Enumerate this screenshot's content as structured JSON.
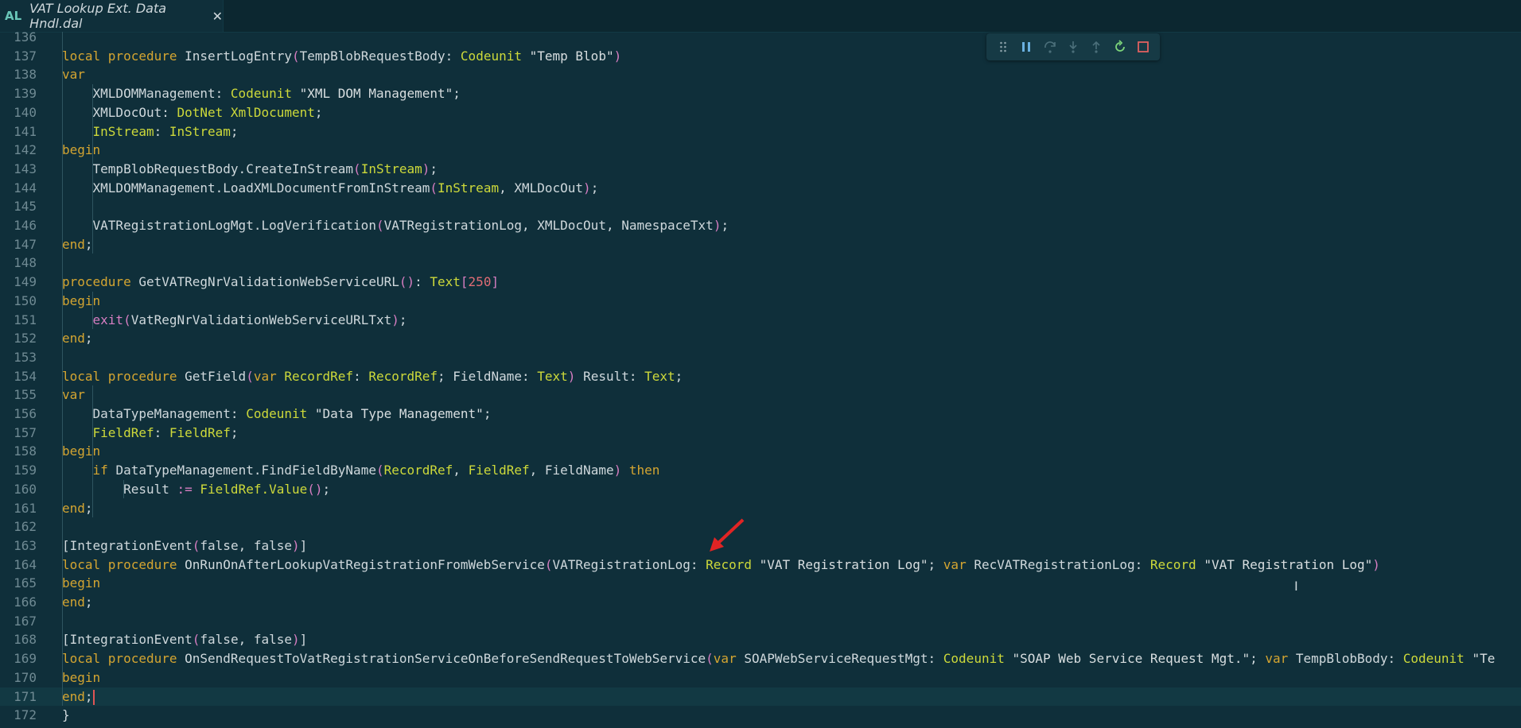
{
  "tab": {
    "language_badge": "AL",
    "title": "VAT Lookup Ext. Data Hndl.dal",
    "close_glyph": "✕"
  },
  "debug_toolbar": {
    "icons": [
      "drag-handle-icon",
      "pause-icon",
      "step-over-icon",
      "step-into-icon",
      "step-out-icon",
      "restart-icon",
      "stop-icon"
    ]
  },
  "editor": {
    "current_line": 171,
    "lines": [
      {
        "n": "136",
        "tokens": []
      },
      {
        "n": "137",
        "tokens": [
          [
            "kw",
            "local procedure "
          ],
          [
            "fn",
            "InsertLogEntry"
          ],
          [
            "par",
            "("
          ],
          [
            "fn",
            "TempBlobRequestBody: "
          ],
          [
            "ty",
            "Codeunit"
          ],
          [
            "str",
            " \"Temp Blob\""
          ],
          [
            "par",
            ")"
          ]
        ]
      },
      {
        "n": "138",
        "tokens": [
          [
            "kw",
            "var"
          ]
        ]
      },
      {
        "n": "139",
        "tokens": [
          [
            "fn",
            "    XMLDOMManagement: "
          ],
          [
            "ty",
            "Codeunit"
          ],
          [
            "str",
            " \"XML DOM Management\""
          ],
          [
            "op",
            ";"
          ]
        ]
      },
      {
        "n": "140",
        "tokens": [
          [
            "fn",
            "    XMLDocOut: "
          ],
          [
            "ty",
            "DotNet XmlDocument"
          ],
          [
            "op",
            ";"
          ]
        ]
      },
      {
        "n": "141",
        "tokens": [
          [
            "ty",
            "    InStream"
          ],
          [
            "op",
            ": "
          ],
          [
            "ty",
            "InStream"
          ],
          [
            "op",
            ";"
          ]
        ]
      },
      {
        "n": "142",
        "tokens": [
          [
            "kw",
            "begin"
          ]
        ]
      },
      {
        "n": "143",
        "tokens": [
          [
            "fn",
            "    TempBlobRequestBody.CreateInStream"
          ],
          [
            "par",
            "("
          ],
          [
            "ty",
            "InStream"
          ],
          [
            "par",
            ")"
          ],
          [
            "op",
            ";"
          ]
        ]
      },
      {
        "n": "144",
        "tokens": [
          [
            "fn",
            "    XMLDOMManagement.LoadXMLDocumentFromInStream"
          ],
          [
            "par",
            "("
          ],
          [
            "ty",
            "InStream"
          ],
          [
            "op",
            ", XMLDocOut"
          ],
          [
            "par",
            ")"
          ],
          [
            "op",
            ";"
          ]
        ]
      },
      {
        "n": "145",
        "tokens": []
      },
      {
        "n": "146",
        "tokens": [
          [
            "fn",
            "    VATRegistrationLogMgt.LogVerification"
          ],
          [
            "par",
            "("
          ],
          [
            "fn",
            "VATRegistrationLog, XMLDocOut, NamespaceTxt"
          ],
          [
            "par",
            ")"
          ],
          [
            "op",
            ";"
          ]
        ]
      },
      {
        "n": "147",
        "tokens": [
          [
            "kw",
            "end"
          ],
          [
            "op",
            ";"
          ]
        ]
      },
      {
        "n": "148",
        "tokens": []
      },
      {
        "n": "149",
        "tokens": [
          [
            "kw",
            "procedure "
          ],
          [
            "fn",
            "GetVATRegNrValidationWebServiceURL"
          ],
          [
            "par",
            "()"
          ],
          [
            "op",
            ": "
          ],
          [
            "ty",
            "Text"
          ],
          [
            "par",
            "["
          ],
          [
            "num",
            "250"
          ],
          [
            "par",
            "]"
          ]
        ]
      },
      {
        "n": "150",
        "tokens": [
          [
            "kw",
            "begin"
          ]
        ]
      },
      {
        "n": "151",
        "tokens": [
          [
            "ctl",
            "    exit"
          ],
          [
            "par",
            "("
          ],
          [
            "fn",
            "VatRegNrValidationWebServiceURLTxt"
          ],
          [
            "par",
            ")"
          ],
          [
            "op",
            ";"
          ]
        ]
      },
      {
        "n": "152",
        "tokens": [
          [
            "kw",
            "end"
          ],
          [
            "op",
            ";"
          ]
        ]
      },
      {
        "n": "153",
        "tokens": []
      },
      {
        "n": "154",
        "tokens": [
          [
            "kw",
            "local procedure "
          ],
          [
            "fn",
            "GetField"
          ],
          [
            "par",
            "("
          ],
          [
            "kw",
            "var "
          ],
          [
            "ty",
            "RecordRef"
          ],
          [
            "op",
            ": "
          ],
          [
            "ty",
            "RecordRef"
          ],
          [
            "op",
            "; FieldName: "
          ],
          [
            "ty",
            "Text"
          ],
          [
            "par",
            ")"
          ],
          [
            "op",
            " Result: "
          ],
          [
            "ty",
            "Text"
          ],
          [
            "op",
            ";"
          ]
        ]
      },
      {
        "n": "155",
        "tokens": [
          [
            "kw",
            "var"
          ]
        ]
      },
      {
        "n": "156",
        "tokens": [
          [
            "fn",
            "    DataTypeManagement: "
          ],
          [
            "ty",
            "Codeunit"
          ],
          [
            "str",
            " \"Data Type Management\""
          ],
          [
            "op",
            ";"
          ]
        ]
      },
      {
        "n": "157",
        "tokens": [
          [
            "ty",
            "    FieldRef"
          ],
          [
            "op",
            ": "
          ],
          [
            "ty",
            "FieldRef"
          ],
          [
            "op",
            ";"
          ]
        ]
      },
      {
        "n": "158",
        "tokens": [
          [
            "kw",
            "begin"
          ]
        ]
      },
      {
        "n": "159",
        "tokens": [
          [
            "kw",
            "    if "
          ],
          [
            "fn",
            "DataTypeManagement.FindFieldByName"
          ],
          [
            "par",
            "("
          ],
          [
            "ty",
            "RecordRef"
          ],
          [
            "op",
            ", "
          ],
          [
            "ty",
            "FieldRef"
          ],
          [
            "op",
            ", FieldName"
          ],
          [
            "par",
            ")"
          ],
          [
            "kw",
            " then"
          ]
        ]
      },
      {
        "n": "160",
        "tokens": [
          [
            "fn",
            "        Result "
          ],
          [
            "ctl",
            ":="
          ],
          [
            "ty",
            " FieldRef.Value"
          ],
          [
            "par",
            "()"
          ],
          [
            "op",
            ";"
          ]
        ]
      },
      {
        "n": "161",
        "tokens": [
          [
            "kw",
            "end"
          ],
          [
            "op",
            ";"
          ]
        ]
      },
      {
        "n": "162",
        "tokens": []
      },
      {
        "n": "163",
        "tokens": [
          [
            "attr",
            "["
          ],
          [
            "fn",
            "IntegrationEvent"
          ],
          [
            "par",
            "("
          ],
          [
            "fn",
            "false, false"
          ],
          [
            "par",
            ")"
          ],
          [
            "attr",
            "]"
          ]
        ]
      },
      {
        "n": "164",
        "tokens": [
          [
            "kw",
            "local procedure "
          ],
          [
            "fn",
            "OnRunOnAfterLookupVatRegistrationFromWebService"
          ],
          [
            "par",
            "("
          ],
          [
            "fn",
            "VATRegistrationLog: "
          ],
          [
            "ty",
            "Record"
          ],
          [
            "str",
            " \"VAT Registration Log\""
          ],
          [
            "op",
            "; "
          ],
          [
            "kw",
            "var "
          ],
          [
            "fn",
            "RecVATRegistrationLog: "
          ],
          [
            "ty",
            "Record"
          ],
          [
            "str",
            " \"VAT Registration Log\""
          ],
          [
            "par",
            ")"
          ]
        ]
      },
      {
        "n": "165",
        "tokens": [
          [
            "kw",
            "begin"
          ]
        ]
      },
      {
        "n": "166",
        "tokens": [
          [
            "kw",
            "end"
          ],
          [
            "op",
            ";"
          ]
        ]
      },
      {
        "n": "167",
        "tokens": []
      },
      {
        "n": "168",
        "tokens": [
          [
            "attr",
            "["
          ],
          [
            "fn",
            "IntegrationEvent"
          ],
          [
            "par",
            "("
          ],
          [
            "fn",
            "false, false"
          ],
          [
            "par",
            ")"
          ],
          [
            "attr",
            "]"
          ]
        ]
      },
      {
        "n": "169",
        "tokens": [
          [
            "kw",
            "local procedure "
          ],
          [
            "fn",
            "OnSendRequestToVatRegistrationServiceOnBeforeSendRequestToWebService"
          ],
          [
            "par",
            "("
          ],
          [
            "kw",
            "var "
          ],
          [
            "fn",
            "SOAPWebServiceRequestMgt: "
          ],
          [
            "ty",
            "Codeunit"
          ],
          [
            "str",
            " \"SOAP Web Service Request Mgt.\""
          ],
          [
            "op",
            "; "
          ],
          [
            "kw",
            "var "
          ],
          [
            "fn",
            "TempBlobBody: "
          ],
          [
            "ty",
            "Codeunit"
          ],
          [
            "str",
            " \"Te"
          ]
        ]
      },
      {
        "n": "170",
        "tokens": [
          [
            "kw",
            "begin"
          ]
        ]
      },
      {
        "n": "171",
        "tokens": [
          [
            "kw",
            "end"
          ],
          [
            "op",
            ";"
          ]
        ]
      },
      {
        "n": "172",
        "tokens": [
          [
            "op",
            "}"
          ]
        ]
      }
    ]
  },
  "colors": {
    "background": "#0f2f3a",
    "keyword": "#d4a531",
    "type": "#cdd93a",
    "paren": "#d77ec2",
    "annotation_arrow": "#e02424"
  }
}
